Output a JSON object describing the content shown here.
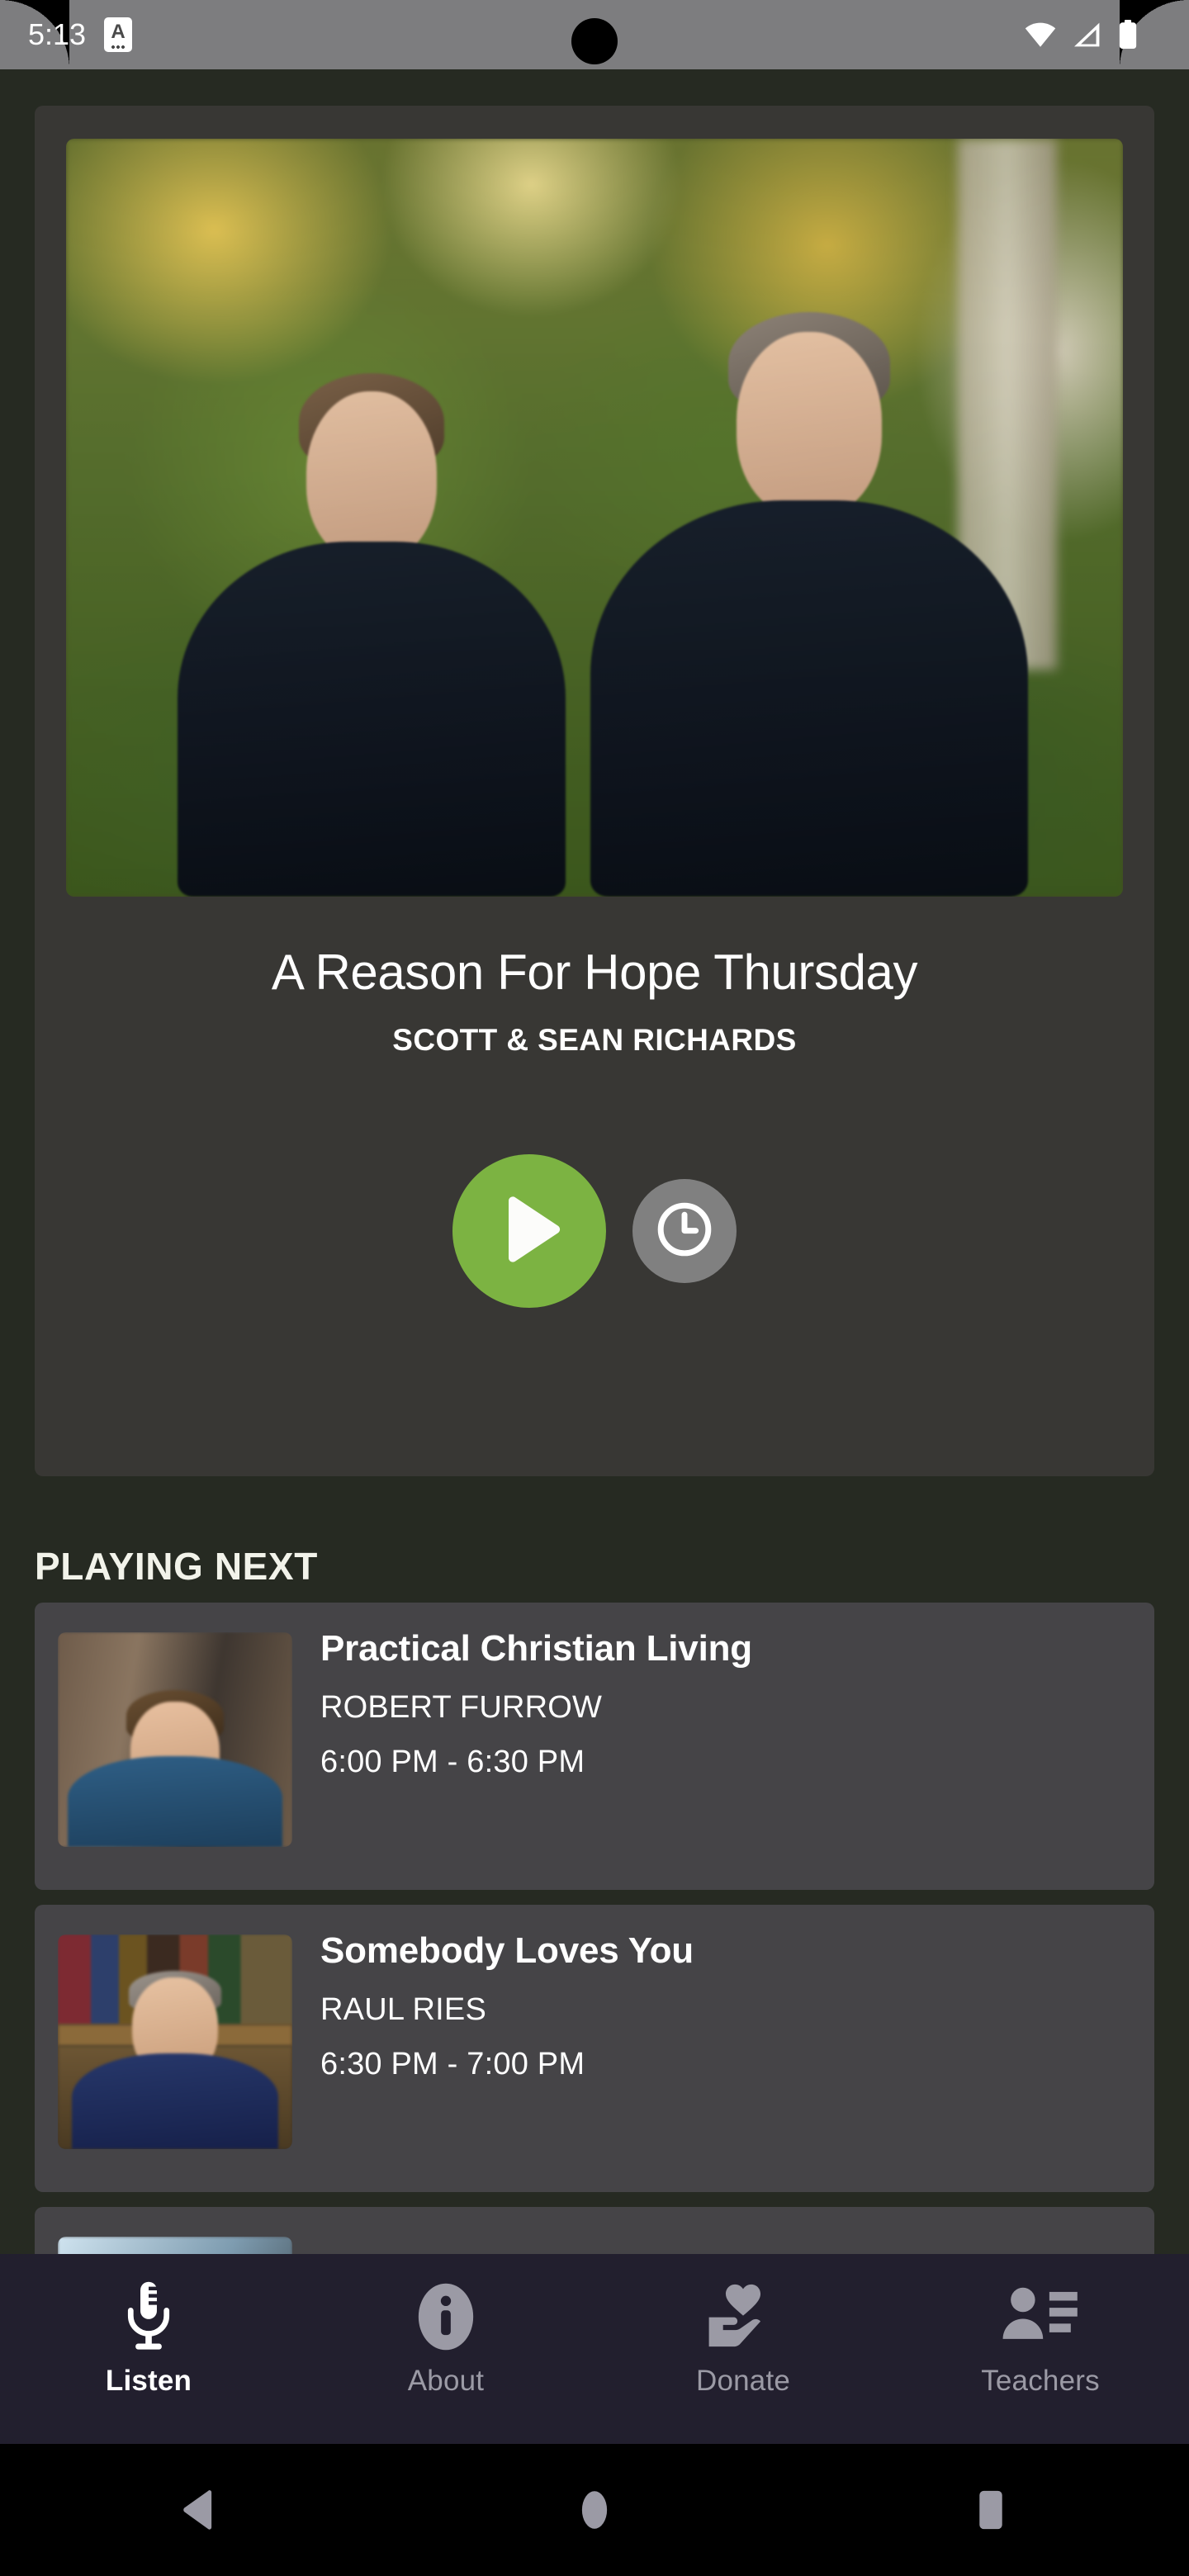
{
  "status_bar": {
    "time": "5:13",
    "app_icon_letter": "A",
    "icons": [
      "wifi-icon",
      "cellular-signal-icon",
      "battery-icon"
    ]
  },
  "hero": {
    "image_alt": "scott-and-sean-richards-photo",
    "title": "A Reason For Hope Thursday",
    "subtitle": "SCOTT & SEAN RICHARDS",
    "play_label": "play-icon",
    "schedule_label": "clock-icon",
    "accent_color": "#7cb342",
    "card_color": "#383734"
  },
  "playing_next": {
    "header": "PLAYING NEXT",
    "items": [
      {
        "title": "Practical Christian Living",
        "author": "ROBERT FURROW",
        "time": "6:00 PM - 6:30 PM",
        "thumb": "robert-furrow-thumbnail"
      },
      {
        "title": "Somebody Loves You",
        "author": "RAUL RIES",
        "time": "6:30 PM - 7:00 PM",
        "thumb": "raul-ries-thumbnail"
      }
    ]
  },
  "tab_bar": {
    "background_color": "#221f2e",
    "active_color": "#ffffff",
    "inactive_color": "#9b9aa5",
    "items": [
      {
        "label": "Listen",
        "icon": "microphone-icon",
        "active": true
      },
      {
        "label": "About",
        "icon": "info-circle-icon",
        "active": false
      },
      {
        "label": "Donate",
        "icon": "hand-heart-icon",
        "active": false
      },
      {
        "label": "Teachers",
        "icon": "person-list-icon",
        "active": false
      }
    ]
  },
  "nav_bar": {
    "back": "back-triangle-icon",
    "home": "home-circle-icon",
    "recents": "recents-square-icon"
  },
  "page_background_color": "#262a22"
}
